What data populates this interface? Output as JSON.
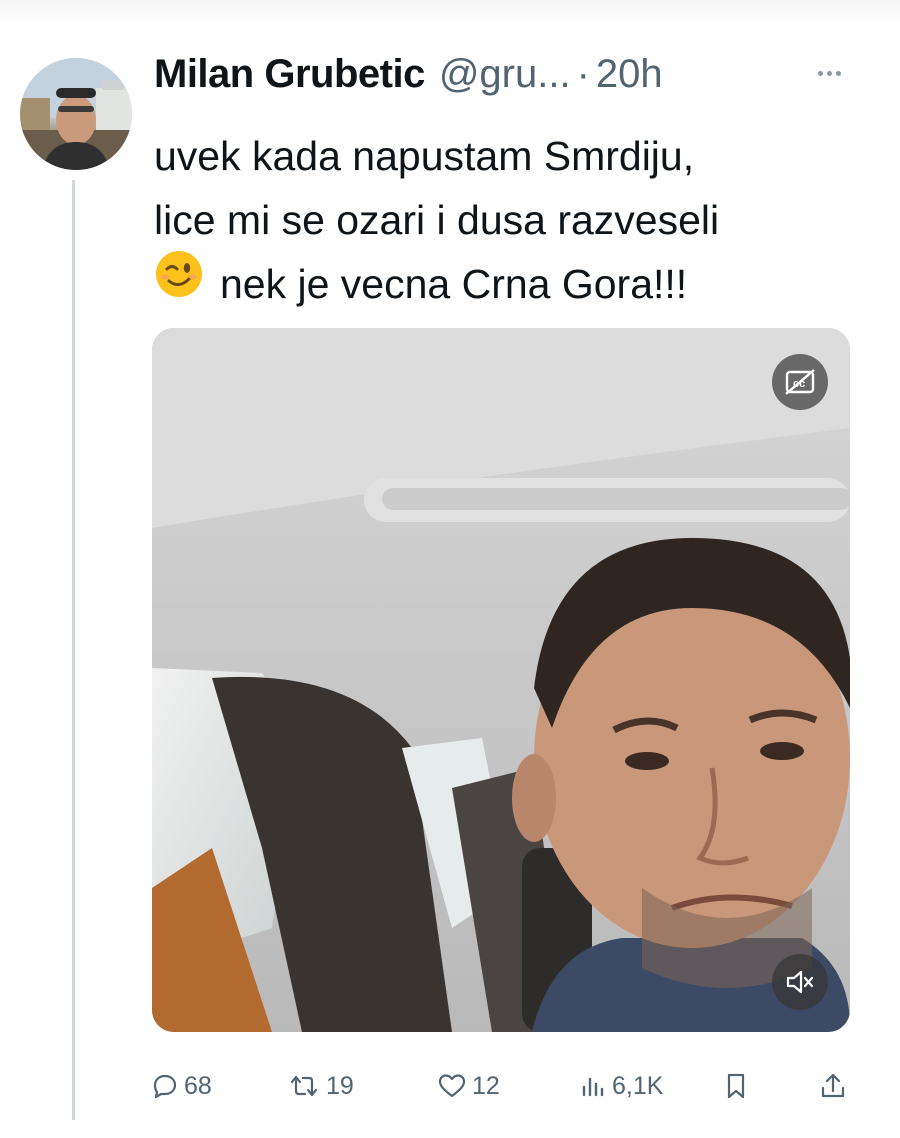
{
  "tweet": {
    "author_name": "Milan Grubetic",
    "author_handle": "@gru...",
    "separator": "·",
    "time": "20h",
    "text_lines": [
      "uvek kada napustam Smrdiju,",
      "lice mi se ozari i dusa razveseli",
      "nek je vecna Crna Gora!!!"
    ],
    "emoji": "😉",
    "media": {
      "type": "video",
      "captions_icon": "captions-off-icon",
      "mute_icon": "muted-speaker-icon"
    }
  },
  "actions": {
    "replies": "68",
    "reposts": "19",
    "likes": "12",
    "views": "6,1K"
  },
  "colors": {
    "text": "#0f1419",
    "secondary": "#536471",
    "thread_line": "#cfd9de"
  }
}
